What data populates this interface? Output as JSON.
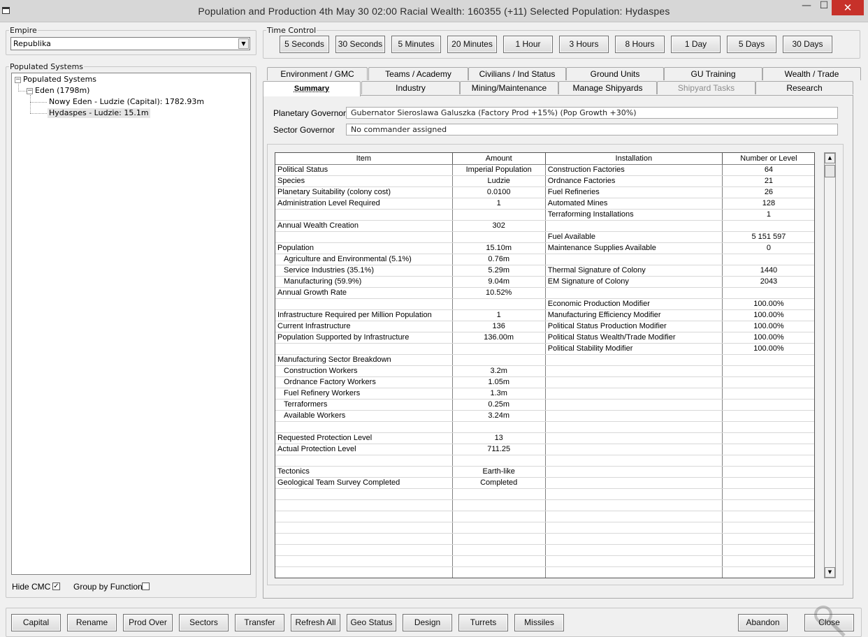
{
  "window": {
    "title": "Population and Production  4th May 30 02:00    Racial Wealth: 160355 (+11)    Selected Population: Hydaspes",
    "minimize": "—",
    "maximize": "☐",
    "close": "✕"
  },
  "empire": {
    "label": "Empire",
    "selected": "Republika",
    "dropdown_icon": "▼"
  },
  "populated": {
    "label": "Populated Systems",
    "root": "Populated Systems",
    "system": "Eden (1798m)",
    "items": [
      "Nowy Eden - Ludzie (Capital): 1782.93m",
      "Hydaspes - Ludzie: 15.1m"
    ],
    "expander": "−"
  },
  "options": {
    "hide_cmc_label": "Hide CMC",
    "hide_cmc_checked": true,
    "hide_cmc_mark": "✓",
    "group_by_function_label": "Group by Function",
    "group_by_function_checked": false
  },
  "time_control": {
    "label": "Time Control",
    "buttons": [
      "5 Seconds",
      "30 Seconds",
      "5 Minutes",
      "20 Minutes",
      "1 Hour",
      "3 Hours",
      "8 Hours",
      "1 Day",
      "5 Days",
      "30 Days"
    ]
  },
  "tabs": {
    "row1": [
      "Environment / GMC",
      "Teams / Academy",
      "Civilians / Ind Status",
      "Ground Units",
      "GU Training",
      "Wealth / Trade"
    ],
    "row2": [
      "Summary",
      "Industry",
      "Mining/Maintenance",
      "Manage Shipyards",
      "Shipyard Tasks",
      "Research"
    ],
    "active": "Summary",
    "disabled": "Shipyard Tasks"
  },
  "governors": {
    "planetary_label": "Planetary Governor",
    "planetary_value": "Gubernator Sieroslawa Galuszka   (Factory Prod +15%)  (Pop Growth +30%)",
    "sector_label": "Sector Governor",
    "sector_value": "No commander assigned"
  },
  "summary_table": {
    "headers": [
      "Item",
      "Amount",
      "Installation",
      "Number or Level"
    ],
    "rows": [
      [
        "Political Status",
        "Imperial Population",
        "Construction Factories",
        "64"
      ],
      [
        "Species",
        "Ludzie",
        "Ordnance Factories",
        "21"
      ],
      [
        "Planetary Suitability (colony cost)",
        "0.0100",
        "Fuel Refineries",
        "26"
      ],
      [
        "Administration Level Required",
        "1",
        "Automated Mines",
        "128"
      ],
      [
        "",
        "",
        "Terraforming Installations",
        "1"
      ],
      [
        "Annual Wealth Creation",
        "302",
        "",
        ""
      ],
      [
        "",
        "",
        "Fuel Available",
        "5 151 597"
      ],
      [
        "Population",
        "15.10m",
        "Maintenance Supplies Available",
        "0"
      ],
      [
        "Agriculture and Environmental  (5.1%)",
        "0.76m",
        "",
        ""
      ],
      [
        "Service Industries  (35.1%)",
        "5.29m",
        "Thermal Signature of Colony",
        "1440"
      ],
      [
        "Manufacturing  (59.9%)",
        "9.04m",
        "EM Signature of Colony",
        "2043"
      ],
      [
        "Annual Growth Rate",
        "10.52%",
        "",
        ""
      ],
      [
        "",
        "",
        "Economic Production Modifier",
        "100.00%"
      ],
      [
        "Infrastructure Required per Million Population",
        "1",
        "Manufacturing Efficiency Modifier",
        "100.00%"
      ],
      [
        "Current Infrastructure",
        "136",
        "Political Status Production Modifier",
        "100.00%"
      ],
      [
        "Population Supported by Infrastructure",
        "136.00m",
        "Political Status Wealth/Trade Modifier",
        "100.00%"
      ],
      [
        "",
        "",
        "Political Stability Modifier",
        "100.00%"
      ],
      [
        "Manufacturing Sector Breakdown",
        "",
        "",
        ""
      ],
      [
        "Construction Workers",
        "3.2m",
        "",
        ""
      ],
      [
        "Ordnance Factory Workers",
        "1.05m",
        "",
        ""
      ],
      [
        "Fuel Refinery Workers",
        "1.3m",
        "",
        ""
      ],
      [
        "Terraformers",
        "0.25m",
        "",
        ""
      ],
      [
        "Available Workers",
        "3.24m",
        "",
        ""
      ],
      [
        "",
        "",
        "",
        ""
      ],
      [
        "Requested Protection Level",
        "13",
        "",
        ""
      ],
      [
        "Actual Protection Level",
        "711.25",
        "",
        ""
      ],
      [
        "",
        "",
        "",
        ""
      ],
      [
        "Tectonics",
        "Earth-like",
        "",
        ""
      ],
      [
        "Geological Team Survey Completed",
        "Completed",
        "",
        ""
      ],
      [
        "",
        "",
        "",
        ""
      ],
      [
        "",
        "",
        "",
        ""
      ],
      [
        "",
        "",
        "",
        ""
      ],
      [
        "",
        "",
        "",
        ""
      ],
      [
        "",
        "",
        "",
        ""
      ],
      [
        "",
        "",
        "",
        ""
      ],
      [
        "",
        "",
        "",
        ""
      ],
      [
        "",
        "",
        "",
        ""
      ]
    ],
    "indented_rows": [
      8,
      9,
      10,
      18,
      19,
      20,
      21,
      22
    ]
  },
  "scroll": {
    "up": "▲",
    "down": "▼"
  },
  "bottom_buttons": [
    "Capital",
    "Rename",
    "Prod Over",
    "Sectors",
    "Transfer",
    "Refresh All",
    "Geo Status",
    "Design",
    "Turrets",
    "Missiles"
  ],
  "abandon": "Abandon",
  "close": "Close"
}
